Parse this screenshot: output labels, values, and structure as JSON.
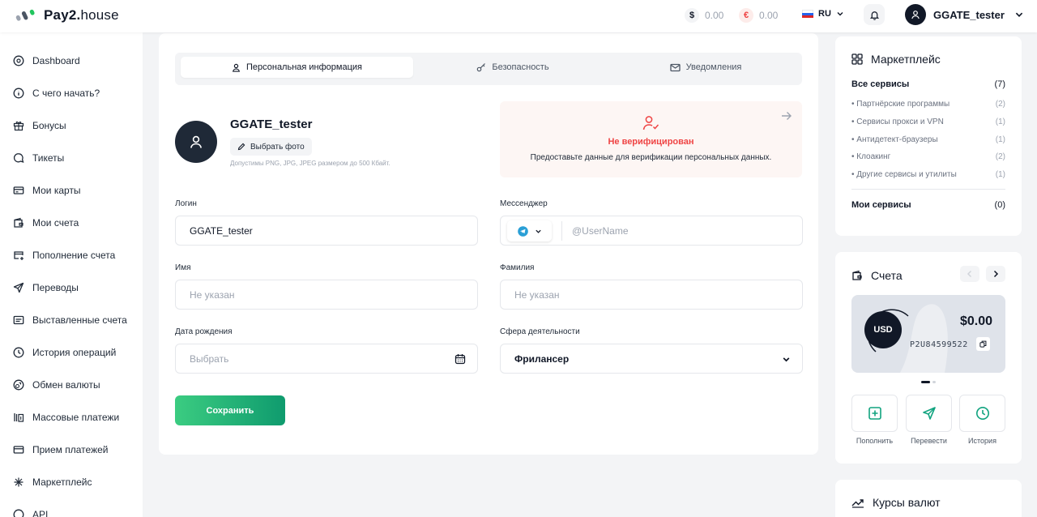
{
  "header": {
    "logo_main": "Pay2.",
    "logo_sub": "house",
    "balances": [
      {
        "symbol": "$",
        "amount": "0.00",
        "icon": "dollar-icon",
        "color": "#111827",
        "bg": "#f3f4f6"
      },
      {
        "symbol": "€",
        "amount": "0.00",
        "icon": "euro-icon",
        "color": "#ef4444",
        "bg": "#fdecea"
      }
    ],
    "language": "RU",
    "user_name": "GGATE_tester"
  },
  "sidebar": {
    "items": [
      {
        "label": "Dashboard",
        "icon": "dashboard-icon"
      },
      {
        "label": "С чего начать?",
        "icon": "info-icon"
      },
      {
        "label": "Бонусы",
        "icon": "gift-icon"
      },
      {
        "label": "Тикеты",
        "icon": "chat-icon"
      },
      {
        "label": "Мои карты",
        "icon": "card-icon"
      },
      {
        "label": "Мои счета",
        "icon": "wallet-icon"
      },
      {
        "label": "Пополнение счета",
        "icon": "topup-icon"
      },
      {
        "label": "Переводы",
        "icon": "send-icon"
      },
      {
        "label": "Выставленные счета",
        "icon": "invoice-icon"
      },
      {
        "label": "История операций",
        "icon": "clock-icon"
      },
      {
        "label": "Обмен валюты",
        "icon": "exchange-icon"
      },
      {
        "label": "Массовые платежи",
        "icon": "mass-pay-icon"
      },
      {
        "label": "Прием платежей",
        "icon": "receive-icon"
      },
      {
        "label": "Маркетплейс",
        "icon": "marketplace-icon"
      },
      {
        "label": "API",
        "icon": "api-icon"
      }
    ]
  },
  "profile": {
    "tabs": [
      {
        "label": "Персональная информация",
        "icon": "user-icon"
      },
      {
        "label": "Безопасность",
        "icon": "key-icon"
      },
      {
        "label": "Уведомления",
        "icon": "mail-icon"
      }
    ],
    "name": "GGATE_tester",
    "choose_photo": "Выбрать фото",
    "photo_hint": "Допустимы PNG, JPG, JPEG размером до 500 Кбайт.",
    "verification": {
      "title": "Не верифицирован",
      "text": "Предоставьте данные для верификации персональных данных."
    },
    "fields": {
      "login_label": "Логин",
      "login_value": "GGATE_tester",
      "messenger_label": "Мессенджер",
      "messenger_placeholder": "@UserName",
      "first_name_label": "Имя",
      "first_name_placeholder": "Не указан",
      "last_name_label": "Фамилия",
      "last_name_placeholder": "Не указан",
      "birth_label": "Дата рождения",
      "birth_placeholder": "Выбрать",
      "activity_label": "Сфера деятельности",
      "activity_value": "Фрилансер"
    },
    "save_label": "Сохранить"
  },
  "marketplace": {
    "title": "Маркетплейс",
    "all_label": "Все сервисы",
    "all_count": "(7)",
    "items": [
      {
        "label": "Партнёрские программы",
        "count": "(2)"
      },
      {
        "label": "Сервисы прокси и VPN",
        "count": "(1)"
      },
      {
        "label": "Антидетект-браузеры",
        "count": "(1)"
      },
      {
        "label": "Клоакинг",
        "count": "(2)"
      },
      {
        "label": "Другие сервисы и утилиты",
        "count": "(1)"
      }
    ],
    "my_label": "Мои сервисы",
    "my_count": "(0)"
  },
  "accounts": {
    "title": "Счета",
    "currency": "USD",
    "amount": "$0.00",
    "number": "P2U84599522",
    "actions": [
      {
        "label": "Пополнить",
        "icon": "plus-square-icon"
      },
      {
        "label": "Перевести",
        "icon": "send-icon"
      },
      {
        "label": "История",
        "icon": "clock-icon"
      }
    ]
  },
  "rates": {
    "title": "Курсы валют"
  },
  "colors": {
    "accent": "#10a37f",
    "danger": "#ef4444",
    "dark": "#111827"
  }
}
